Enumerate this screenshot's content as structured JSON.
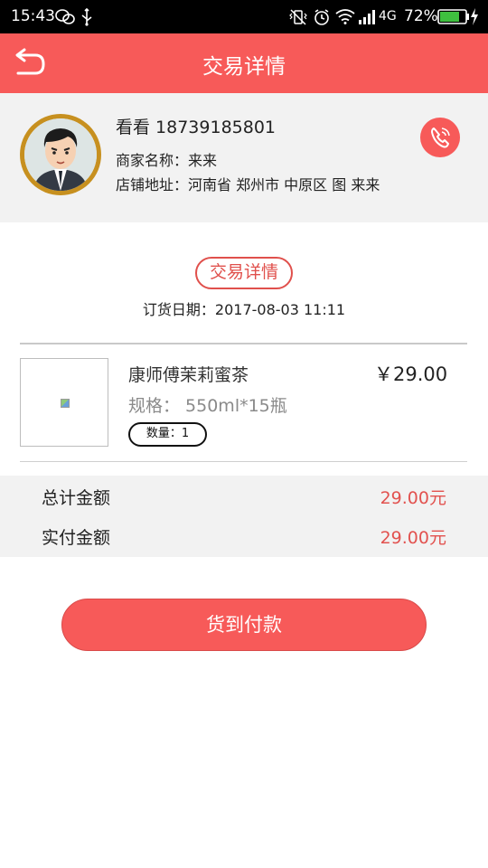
{
  "status_bar": {
    "time": "15:43",
    "network": "4G",
    "battery_percent": "72%",
    "icons": [
      "wechat-icon",
      "usb-icon",
      "vibrate-icon",
      "alarm-icon",
      "wifi-icon",
      "signal-icon",
      "battery-icon",
      "charging-icon"
    ]
  },
  "header": {
    "title": "交易详情",
    "back_icon": "back-arrow-icon"
  },
  "merchant": {
    "name_phone": "看看 18739185801",
    "merchant_name": "商家名称：来来",
    "shop_address": "店铺地址：河南省 郑州市 中原区 图 来来",
    "phone_icon": "phone-icon"
  },
  "trade": {
    "badge": "交易详情",
    "order_date": "订货日期：2017-08-03 11:11"
  },
  "product": {
    "name": "康师傅茉莉蜜茶",
    "spec": "规格： 550ml*15瓶",
    "price": "￥29.00",
    "quantity": "数量：1"
  },
  "totals": {
    "total_label": "总计金额",
    "total_value": "29.00元",
    "paid_label": "实付金额",
    "paid_value": "29.00元"
  },
  "actions": {
    "pay_button": "货到付款"
  },
  "colors": {
    "brand": "#f75a59",
    "price_red": "#e2524f",
    "avatar_ring": "#c7901f"
  }
}
